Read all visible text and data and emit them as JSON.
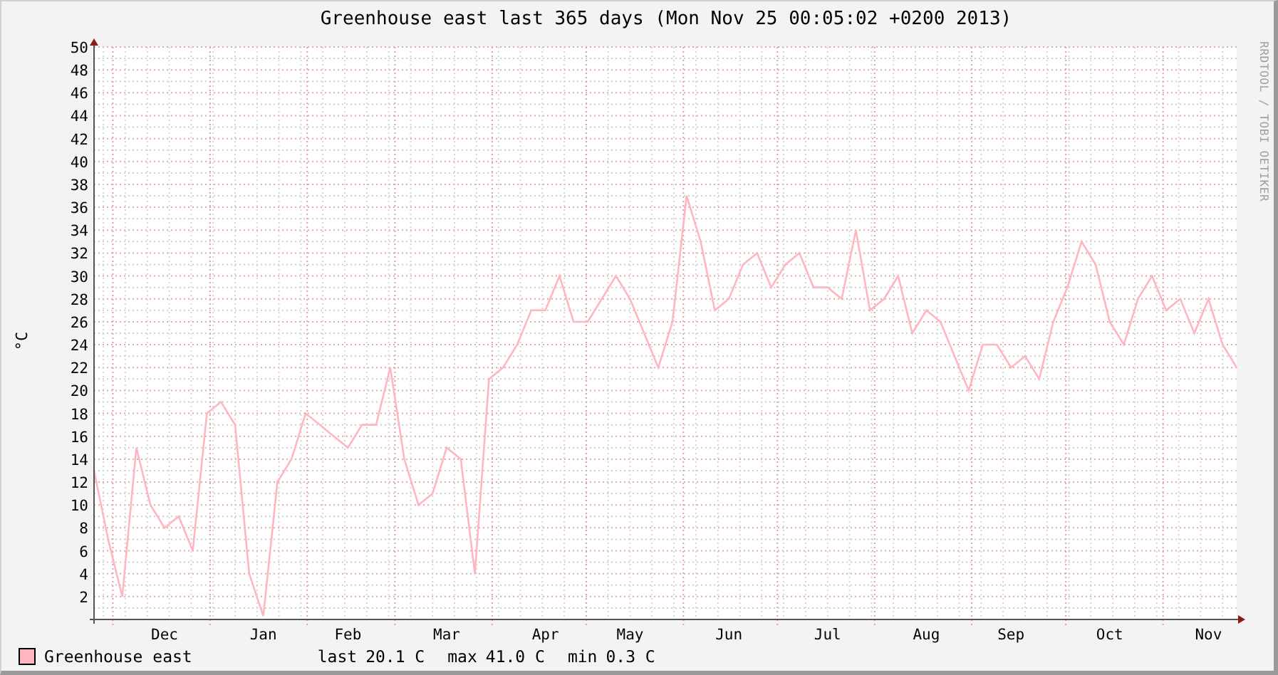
{
  "title": "Greenhouse east last 365 days (Mon Nov 25 00:05:02 +0200 2013)",
  "credit": "RRDTOOL / TOBI OETIKER",
  "chart_data": {
    "type": "line",
    "grid": true,
    "ylabel": "°C",
    "ylim": [
      0,
      50
    ],
    "yticks": [
      2,
      4,
      6,
      8,
      10,
      12,
      14,
      16,
      18,
      20,
      22,
      24,
      26,
      28,
      30,
      32,
      34,
      36,
      38,
      40,
      42,
      44,
      46,
      48,
      50
    ],
    "categories": [
      null,
      null,
      null,
      null,
      null,
      "Dec",
      null,
      null,
      null,
      null,
      null,
      null,
      "Jan",
      null,
      null,
      null,
      null,
      null,
      "Feb",
      null,
      null,
      null,
      null,
      null,
      null,
      "Mar",
      null,
      null,
      null,
      null,
      null,
      null,
      "Apr",
      null,
      null,
      null,
      null,
      null,
      "May",
      null,
      null,
      null,
      null,
      null,
      null,
      "Jun",
      null,
      null,
      null,
      null,
      null,
      null,
      "Jul",
      null,
      null,
      null,
      null,
      null,
      null,
      "Aug",
      null,
      null,
      null,
      null,
      null,
      "Sep",
      null,
      null,
      null,
      null,
      null,
      null,
      "Oct",
      null,
      null,
      null,
      null,
      null,
      null,
      "Nov",
      null,
      null
    ],
    "series": [
      {
        "name": "Greenhouse east",
        "color": "#ffb6c1",
        "values": [
          13,
          7,
          2,
          15,
          10,
          8,
          9,
          6,
          18,
          19,
          17,
          4,
          0.3,
          12,
          14,
          18,
          17,
          16,
          15,
          17,
          17,
          22,
          14,
          10,
          11,
          15,
          14,
          4,
          21,
          22,
          24,
          27,
          27,
          30,
          26,
          26,
          28,
          30,
          28,
          25,
          22,
          26,
          37,
          33,
          27,
          28,
          31,
          32,
          29,
          31,
          32,
          29,
          29,
          28,
          34,
          27,
          28,
          30,
          25,
          27,
          26,
          23,
          20,
          24,
          24,
          22,
          23,
          21,
          26,
          29,
          33,
          31,
          26,
          24,
          28,
          30,
          27,
          28,
          25,
          28,
          24,
          22
        ]
      }
    ]
  },
  "legend": {
    "stats": [
      {
        "name": "last",
        "value": "20.1 C"
      },
      {
        "name": "max",
        "value": "41.0 C"
      },
      {
        "name": "min",
        "value": "0.3 C"
      }
    ]
  }
}
